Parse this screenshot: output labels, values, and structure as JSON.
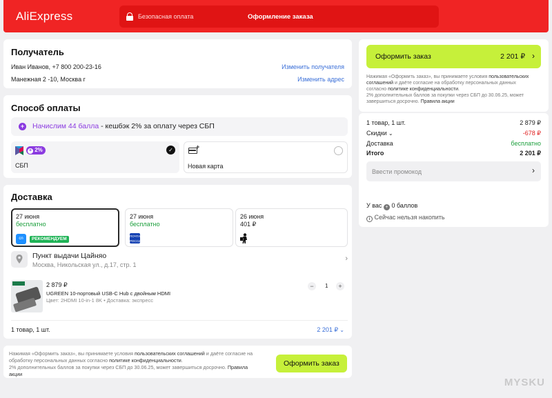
{
  "header": {
    "logo": "AliExpress",
    "secure_payment": "Безопасная оплата",
    "checkout_title": "Оформление заказа"
  },
  "recipient": {
    "title": "Получатель",
    "name_phone": "Иван Иванов, +7 800 200-23-16",
    "change_recipient": "Изменить получателя",
    "address": "Манежная 2 -10, Москва г",
    "change_address": "Изменить адрес"
  },
  "payment": {
    "title": "Способ оплаты",
    "cashback_highlight": "Начислим 44 балла",
    "cashback_rest": " - кешбэк 2% за оплату через СБП",
    "sbp_badge": "2%",
    "sbp_label": "СБП",
    "new_card_label": "Новая карта"
  },
  "delivery": {
    "title": "Доставка",
    "options": [
      {
        "date": "27 июня",
        "price": "бесплатно",
        "badge": "РЕКОМЕНДУЕМ",
        "carrier_icon": "cainiao"
      },
      {
        "date": "27 июня",
        "price": "бесплатно",
        "carrier_icon": "russian-post"
      },
      {
        "date": "26 июня",
        "price": "401 ₽",
        "carrier_icon": "courier"
      }
    ],
    "pickup_title": "Пункт выдачи Цайняо",
    "pickup_address": "Москва, Никольская ул., д.17, стр. 1",
    "product": {
      "price": "2 879 ₽",
      "name": "UGREEN 10-портовый USB-C Hub с двойным HDMI",
      "meta": "Цвет: 2HDMI 10-in-1 8K • Доставка: экспресс",
      "qty": "1",
      "minus": "−",
      "plus": "+"
    },
    "summary_left": "1 товар, 1 шт.",
    "summary_right": "2 201 ₽"
  },
  "bottom": {
    "agree_1": "Нажимая «Оформить заказ», вы принимаете условия ",
    "agree_link1": "пользовательских соглашений",
    "agree_2": " и даёте согласие на",
    "agree_3": "обработку персональных данных согласно ",
    "agree_link2": "политике конфиденциальности",
    "agree_4": ".",
    "bonus_note": "2% дополнительных баллов за покупки через СБП до 30.06.25, может завершиться досрочно.",
    "bonus_link": "Правила",
    "bonus_link2": "акции",
    "button": "Оформить заказ"
  },
  "sidebar": {
    "order_button": "Оформить заказ",
    "order_total": "2 201 ₽",
    "agree_1": "Нажимая «Оформить заказ», вы принимаете условия ",
    "agree_link1": "пользовательских",
    "agree_link1b": "соглашений",
    "agree_2": " и даёте согласие на обработку персональных данных",
    "agree_3": "согласно ",
    "agree_link2": "политике конфиденциальности",
    "agree_4": ".",
    "bonus_1": "2% дополнительных баллов за покупки через СБП до 30.06.25, может",
    "bonus_2": "завершиться досрочно. ",
    "bonus_link": "Правила акции",
    "items_label": "1 товар, 1 шт.",
    "items_value": "2 879 ₽",
    "discounts_label": "Скидки",
    "discounts_value": "-678 ₽",
    "delivery_label": "Доставка",
    "delivery_value": "бесплатно",
    "total_label": "Итого",
    "total_value": "2 201 ₽",
    "promo_placeholder": "Ввести промокод",
    "points": "У вас",
    "points_value": "0 баллов",
    "cannot_accumulate": "Сейчас нельзя накопить"
  },
  "watermark": "MYSKU",
  "colors": {
    "brand_red": "#f02424",
    "accent_green": "#c6f03a",
    "link_blue": "#3a6fd8",
    "cashback_purple": "#8b3be0"
  }
}
